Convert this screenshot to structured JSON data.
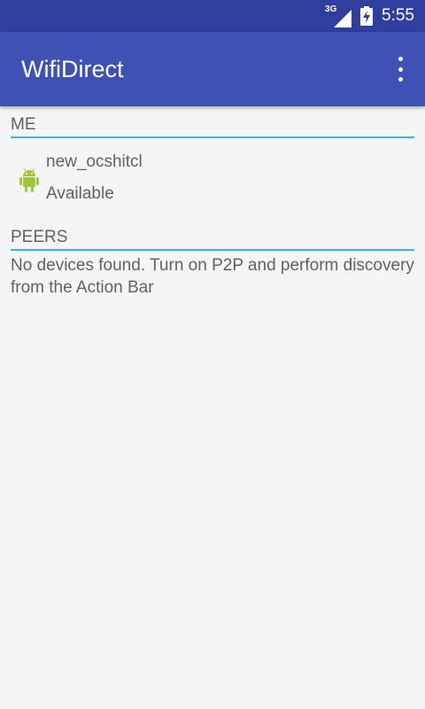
{
  "status_bar": {
    "network": "3G",
    "time": "5:55"
  },
  "app_bar": {
    "title": "WifiDirect",
    "menu_icon": "more-vert-icon"
  },
  "me_section": {
    "header": "ME",
    "device": {
      "icon": "android-icon",
      "name": "new_ocshitcl",
      "status": "Available"
    }
  },
  "peers_section": {
    "header": "PEERS",
    "empty_message": "No devices found. Turn on P2P and perform discovery from the Action Bar"
  },
  "colors": {
    "status_bar": "#303f9f",
    "app_bar": "#3f51b5",
    "divider": "#33b5e5",
    "android": "#a4c639"
  }
}
